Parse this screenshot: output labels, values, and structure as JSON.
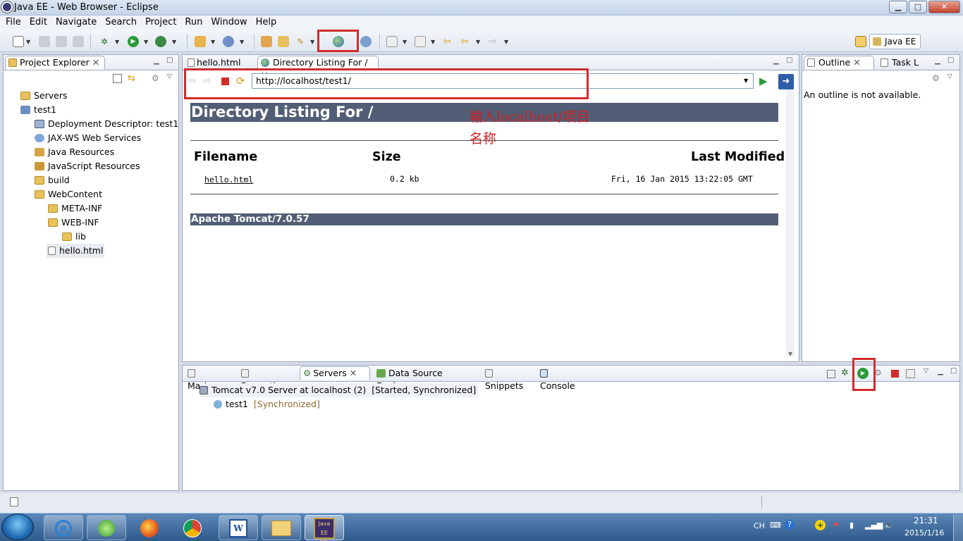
{
  "window": {
    "title": "Java EE - Web Browser - Eclipse",
    "min": "▁",
    "max": "□",
    "close": "✕"
  },
  "menu": [
    "File",
    "Edit",
    "Navigate",
    "Search",
    "Project",
    "Run",
    "Window",
    "Help"
  ],
  "perspective": {
    "label": "Java EE"
  },
  "project_explorer": {
    "tab": "Project Explorer",
    "items": [
      {
        "label": "Servers",
        "icon": "folder-icon"
      },
      {
        "label": "test1",
        "icon": "project-icon"
      },
      {
        "label": "Deployment Descriptor: test1",
        "icon": "descriptor-icon"
      },
      {
        "label": "JAX-WS Web Services",
        "icon": "webservice-icon"
      },
      {
        "label": "Java Resources",
        "icon": "java-resources-icon"
      },
      {
        "label": "JavaScript Resources",
        "icon": "javascript-icon"
      },
      {
        "label": "build",
        "icon": "folder-icon"
      },
      {
        "label": "WebContent",
        "icon": "folder-icon"
      },
      {
        "label": "META-INF",
        "icon": "folder-icon"
      },
      {
        "label": "WEB-INF",
        "icon": "folder-icon"
      },
      {
        "label": "lib",
        "icon": "folder-icon"
      },
      {
        "label": "hello.html",
        "icon": "file-icon"
      }
    ]
  },
  "editor": {
    "tabs": [
      "hello.html",
      "Directory Listing For /"
    ],
    "url": "http://localhost/test1/"
  },
  "page": {
    "heading": "Directory Listing For /",
    "columns": [
      "Filename",
      "Size",
      "Last Modified"
    ],
    "rows": [
      {
        "filename": "hello.html",
        "size": "0.2 kb",
        "modified": "Fri, 16 Jan 2015 13:22:05 GMT"
      }
    ],
    "footer": "Apache Tomcat/7.0.57"
  },
  "annotation": {
    "line1": "输入localhoat/项目",
    "line2": "名称"
  },
  "outline": {
    "tabs": [
      "Outline",
      "Task L"
    ],
    "message": "An outline is not available."
  },
  "bottom": {
    "tabs": [
      "Markers",
      "Properties",
      "Servers",
      "Data Source Explorer",
      "Snippets",
      "Console"
    ],
    "server": {
      "label": "Tomcat v7.0 Server at localhost (2)",
      "state": "[Started, Synchronized]"
    },
    "module": {
      "label": "test1",
      "state": "[Synchronized]"
    }
  },
  "taskbar": {
    "lang": "CH",
    "time": "21:31",
    "date": "2015/1/16",
    "app_label": "Java EE IDE"
  }
}
